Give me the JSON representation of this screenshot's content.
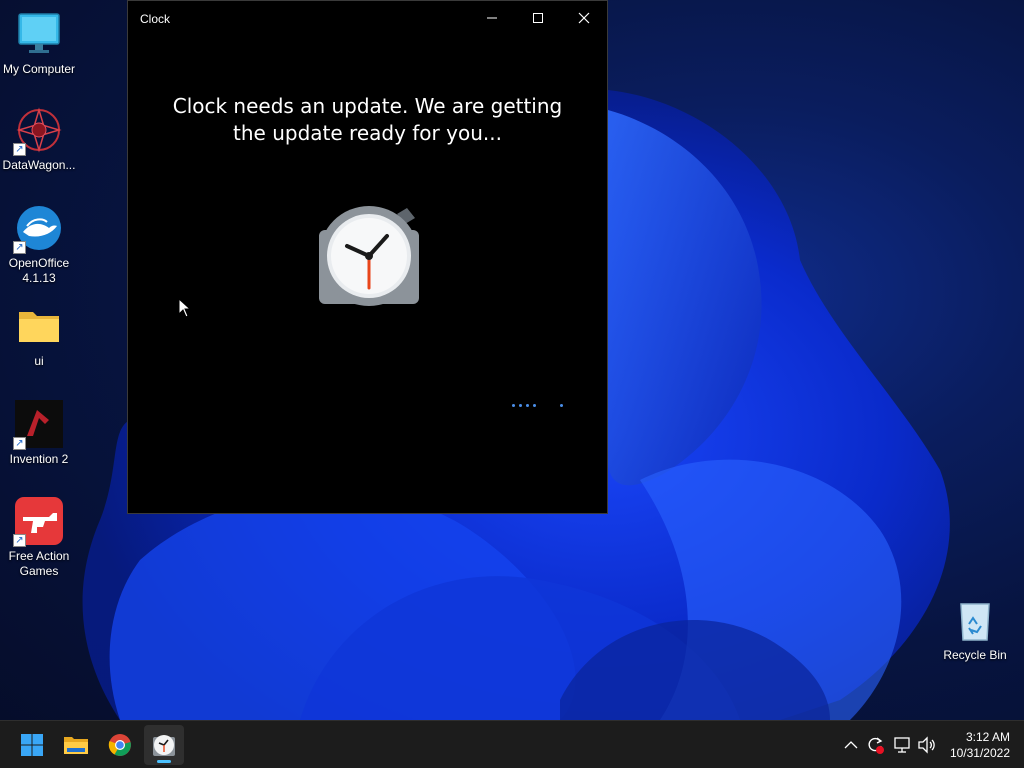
{
  "desktop": {
    "icons": [
      {
        "label": "My Computer",
        "shortcut": false,
        "icon": "monitor-icon"
      },
      {
        "label": "DataWagon...",
        "shortcut": true,
        "icon": "datawagon-icon"
      },
      {
        "label": "OpenOffice\n4.1.13",
        "line1": "OpenOffice",
        "line2": "4.1.13",
        "shortcut": true,
        "icon": "openoffice-icon"
      },
      {
        "label": "ui",
        "shortcut": false,
        "icon": "folder-icon"
      },
      {
        "label": "Invention 2",
        "shortcut": true,
        "icon": "invention-icon"
      },
      {
        "label": "Free Action\nGames",
        "line1": "Free Action",
        "line2": "Games",
        "shortcut": true,
        "icon": "free-action-games-icon"
      },
      {
        "label": "Recycle Bin",
        "shortcut": false,
        "icon": "recycle-bin-icon"
      }
    ]
  },
  "window": {
    "title": "Clock",
    "message_line1": "Clock needs an update. We are getting",
    "message_line2": "the update ready for you...",
    "app_icon": "alarm-clock-icon",
    "buttons": {
      "minimize": "minimize-icon",
      "maximize": "maximize-icon",
      "close": "close-icon"
    }
  },
  "taskbar": {
    "apps": [
      {
        "name": "Start",
        "icon": "windows-start-icon"
      },
      {
        "name": "File Explorer",
        "icon": "file-explorer-icon"
      },
      {
        "name": "Google Chrome",
        "icon": "chrome-icon"
      },
      {
        "name": "Clock",
        "icon": "clock-icon",
        "active": true
      }
    ],
    "tray": [
      "chevron-up-icon",
      "sync-icon",
      "network-icon",
      "volume-icon"
    ],
    "time": "3:12 AM",
    "date": "10/31/2022"
  },
  "colors": {
    "accent": "#4cc2ff",
    "taskbar": "#1c1c1c",
    "window_bg": "#000000"
  }
}
